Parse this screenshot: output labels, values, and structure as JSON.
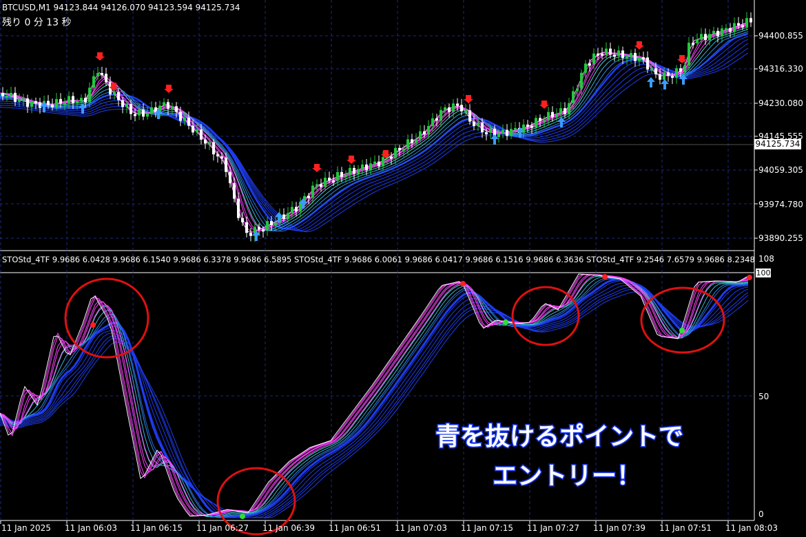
{
  "header": {
    "symbol_line": "BTCUSD,M1  94123.844 94126.070 94123.594 94125.734",
    "countdown": "残り 0 分 13 秒"
  },
  "price_axis": {
    "labels": [
      "94400.855",
      "94316.330",
      "94230.080",
      "94145.555",
      "94059.305",
      "93974.780",
      "93890.255"
    ],
    "current_price": "94125.734"
  },
  "indicator": {
    "header": "STOStd_4TF 9.9686 6.0428 9.9686 6.1540 9.9686 6.3378 9.9686 6.5895  STOStd_4TF 9.9686 6.0061 9.9686 6.0417 9.9686 6.1516 9.9686 6.3636  STOStd_4TF 9.2546 7.6579 9.9686 8.2348",
    "scale_max": "108",
    "scale_current": "100",
    "scale_mid": "50",
    "scale_min": "0"
  },
  "time_axis": {
    "labels": [
      "11 Jan 2025",
      "11 Jan 06:03",
      "11 Jan 06:15",
      "11 Jan 06:27",
      "11 Jan 06:39",
      "11 Jan 06:51",
      "11 Jan 07:03",
      "11 Jan 07:15",
      "11 Jan 07:27",
      "11 Jan 07:39",
      "11 Jan 07:51",
      "11 Jan 08:03"
    ]
  },
  "annotation": {
    "line1": "青を抜けるポイントで",
    "line2": "エントリー！"
  },
  "colors": {
    "background": "#000000",
    "bull_candle": "#22c83c",
    "bear_candle": "#ffffff",
    "ma_fast": "#ff44ff",
    "ma_mid": "#40e0d0",
    "ma_slow": "#1e3cf0",
    "grid": "#1b2a80",
    "circle": "#e01010",
    "up_arrow": "#3a9cff",
    "down_arrow": "#ff2020"
  }
}
